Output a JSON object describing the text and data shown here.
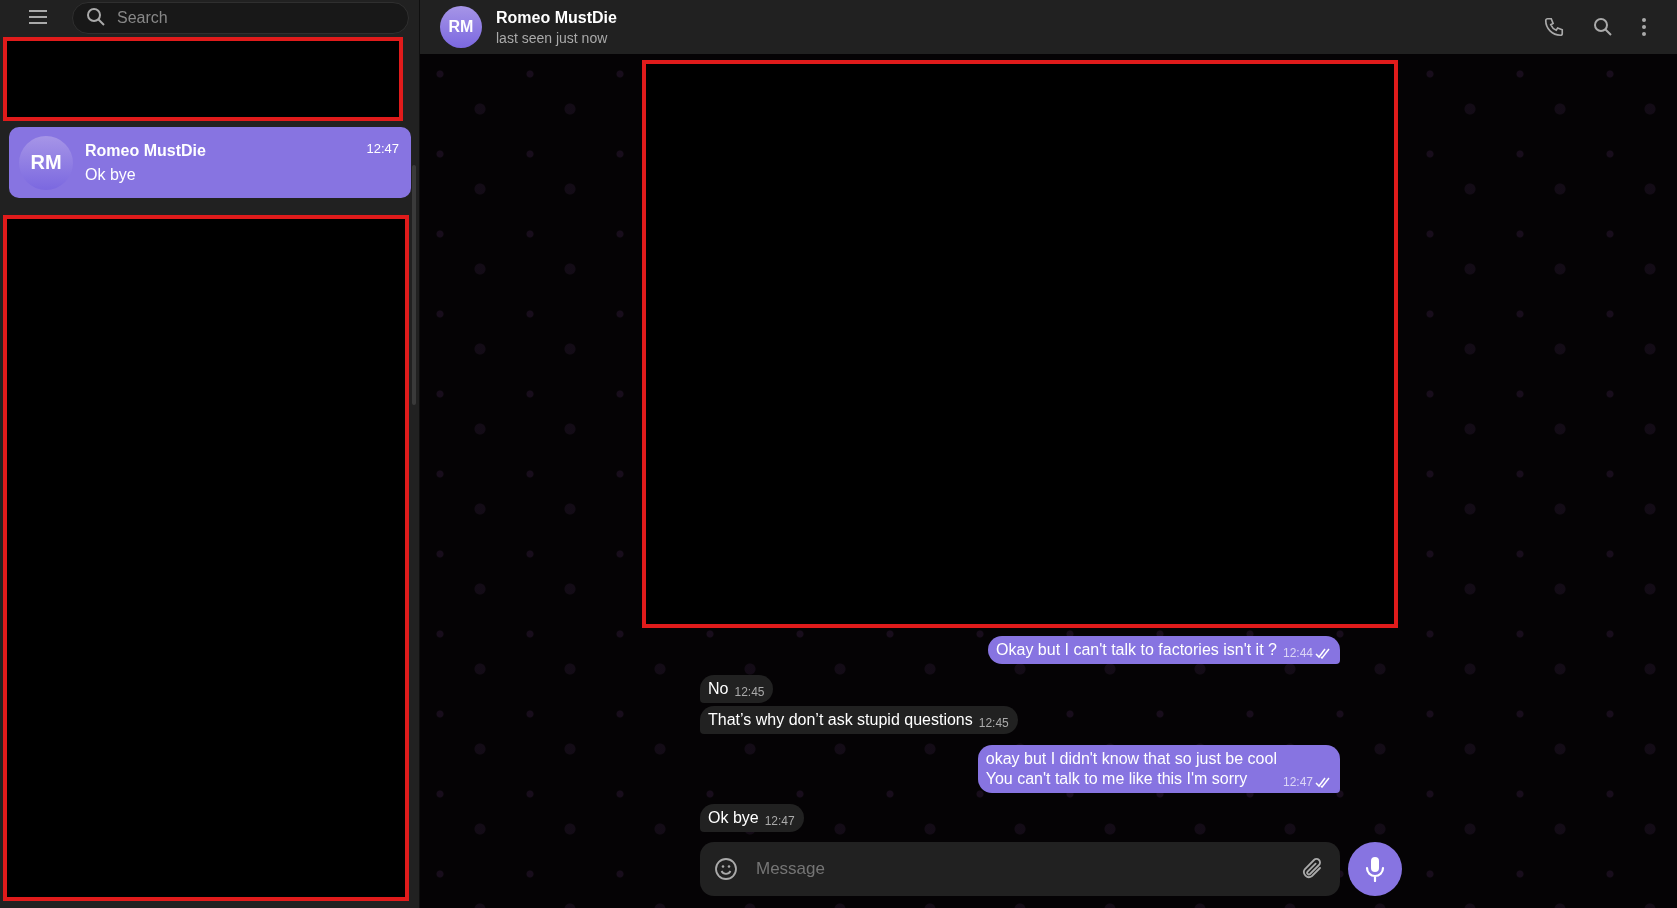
{
  "sidebar": {
    "search": {
      "placeholder": "Search"
    },
    "chats": [
      {
        "initials": "RM",
        "name": "Romeo MustDie",
        "time": "12:47",
        "preview": "Ok bye",
        "selected": true
      }
    ]
  },
  "chat_header": {
    "initials": "RM",
    "name": "Romeo MustDie",
    "status": "last seen just now"
  },
  "messages": [
    {
      "kind": "outgoing",
      "lines": [
        "Okay but I can't talk to factories isn't it ?"
      ],
      "time": "12:44",
      "read": true
    },
    {
      "kind": "incoming",
      "lines": [
        "No"
      ],
      "time": "12:45"
    },
    {
      "kind": "incoming",
      "lines": [
        "That’s why don’t ask stupid questions"
      ],
      "time": "12:45"
    },
    {
      "kind": "outgoing",
      "lines": [
        "okay but I didn't know that so just be cool",
        "You can't talk to me like this I'm sorry"
      ],
      "time": "12:47",
      "read": true
    },
    {
      "kind": "incoming",
      "lines": [
        "Ok bye"
      ],
      "time": "12:47"
    }
  ],
  "composer": {
    "placeholder": "Message"
  }
}
